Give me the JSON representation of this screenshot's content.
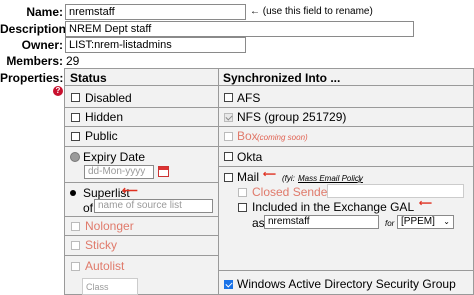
{
  "fields": {
    "name_label": "Name:",
    "name_value": "nremstaff",
    "name_hint": "← (use this field to rename)",
    "description_label": "Description:",
    "description_value": "NREM Dept staff",
    "owner_label": "Owner:",
    "owner_value": "LIST:nrem-listadmins",
    "members_label": "Members:",
    "members_value": "29",
    "properties_label": "Properties:"
  },
  "status": {
    "header": "Status",
    "disabled": "Disabled",
    "hidden": "Hidden",
    "public": "Public",
    "expiry_date": "Expiry Date",
    "expiry_placeholder": "dd-Mon-yyyy",
    "superlist": "Superlist",
    "of_label": "of",
    "source_placeholder": "name of source list",
    "nolonger": "Nolonger",
    "sticky": "Sticky",
    "autolist": "Autolist",
    "class_placeholder": "Class"
  },
  "sync": {
    "header": "Synchronized Into ...",
    "afs": "AFS",
    "nfs": "NFS (group 251729)",
    "box": "Box",
    "box_note": "(coming soon)",
    "okta": "Okta",
    "mail": "Mail",
    "mail_note": "(fyi:",
    "mail_link": "Mass Email Policy",
    "mail_note_end": ")",
    "closed_senders": "Closed Senders",
    "exchange_gal": "Included in the Exchange GAL",
    "as_label": "as",
    "as_value": "nremstaff",
    "for_label": "for",
    "for_value": "[PPEM]",
    "windows_ad": "Windows Active Directory Security Group"
  },
  "colors": {
    "accent": "#1a73e8",
    "disabled_text": "#e07a6b",
    "help_icon": "#c8102e",
    "table_bg": "#f2f2f2"
  }
}
